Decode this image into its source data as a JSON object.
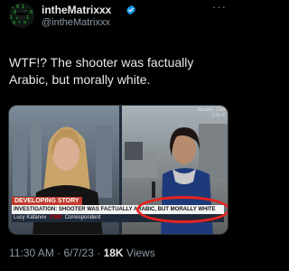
{
  "author": {
    "name": "intheMatrixxx",
    "handle": "@intheMatrixxx",
    "verified": true,
    "avatar": "avatar-image"
  },
  "menu_icon": "more-icon",
  "tweet": {
    "text": "WTF!? The shooter was factually Arabic, but morally white."
  },
  "media": {
    "location": "Boulder, Colo",
    "time": "1:01 P",
    "tag": "DEVELOPING STORY",
    "headline": "INVESTIGATION: SHOOTER WAS FACTUALLY ARABIC, BUT MORALLY WHITE",
    "reporter": "Lucy Kafanov",
    "network": "CNN",
    "role": "Correspondent",
    "highlight_color": "#e8231f"
  },
  "meta": {
    "time": "11:30 AM",
    "separator": "·",
    "date": "6/7/23",
    "views_count": "18K",
    "views_label": "Views"
  },
  "colors": {
    "background": "#000000",
    "text": "#e7e9ea",
    "secondary": "#8b98a5",
    "verified": "#1d9bf0",
    "chyron_red": "#c0392b"
  }
}
